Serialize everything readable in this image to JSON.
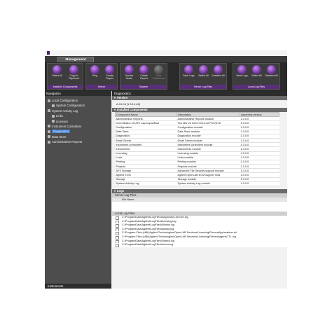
{
  "tab": "Management",
  "ribbon": {
    "groups": [
      {
        "label": "Installed Components",
        "buttons": [
          {
            "label": "Select All"
          },
          {
            "label": "Copy to Clipboard"
          }
        ]
      },
      {
        "label": "Server",
        "buttons": [
          {
            "label": "Ping"
          },
          {
            "label": "Create Report"
          }
        ]
      },
      {
        "label": "System",
        "buttons": [
          {
            "label": "Service Mode"
          },
          {
            "label": "Create Report"
          },
          {
            "label": "Start Dashboard",
            "disabled": true
          }
        ]
      },
      {
        "label": "Server Log Files",
        "buttons": [
          {
            "label": "Save Logs"
          },
          {
            "label": "Select All"
          },
          {
            "label": "Deselect All"
          }
        ]
      },
      {
        "label": "Local Log Files",
        "buttons": [
          {
            "label": "Save Logs"
          },
          {
            "label": "Select All"
          },
          {
            "label": "Deselect All"
          }
        ]
      }
    ]
  },
  "navigation": {
    "title": "Navigation",
    "items": [
      {
        "label": "Local Configuration",
        "sub": false
      },
      {
        "label": "System Configuration",
        "sub": true
      },
      {
        "label": "System Activity Log",
        "sub": false
      },
      {
        "label": "Links",
        "sub": true
      },
      {
        "label": "Licenses",
        "sub": true
      },
      {
        "label": "Instrument Controllers",
        "sub": false
      },
      {
        "label": "Diagnostics",
        "sub": false,
        "selected": true
      },
      {
        "label": "Data Store",
        "sub": false
      },
      {
        "label": "Administrative Reports",
        "sub": false
      }
    ],
    "footer": "Instruments"
  },
  "main": {
    "title": "Diagnostics",
    "version_section": "Version",
    "version_value": "A.01.04 [1.3.10.48]",
    "components_section": "Installed Components",
    "columns": [
      "Component Name",
      "Description",
      "Assembly version"
    ],
    "rows": [
      [
        "Administrative Reports",
        "Administrative Reports module",
        "1.3.0.0"
      ],
      [
        "ChemStation OL/DS LaunchpadMod",
        "Thu Mar 22 2012 04:10:42 PM ON  E",
        "1.3.0.0"
      ],
      [
        "Configuration",
        "Configuration module",
        "1.3.0.0"
      ],
      [
        "Data Store",
        "Data Store module",
        "1.3.0.0"
      ],
      [
        "Diagnostics",
        "Diagnostics module",
        "1.3.0.0"
      ],
      [
        "Email Server",
        "Email Server module",
        "1.3.0.0"
      ],
      [
        "Instrument controllers",
        "Instrument controllers module",
        "1.3.0.0"
      ],
      [
        "Instruments",
        "Instruments module",
        "1.3.0.0"
      ],
      [
        "Licensing",
        "Licensing module",
        "1.3.0.0"
      ],
      [
        "Links",
        "Links module",
        "1.3.0.0"
      ],
      [
        "Printing",
        "Printing module",
        "1.3.0.0"
      ],
      [
        "Projects",
        "Projects module",
        "1.3.0.0"
      ],
      [
        "AFS Storage",
        "Advanced File Security support module",
        "1.3.0.0"
      ],
      [
        "Agilent ECM",
        "Agilent OpenLAB ECM support mod",
        "1.3.0.0"
      ],
      [
        "Storage",
        "Storage module",
        "1.3.0.0"
      ],
      [
        "System Activity Log",
        "System Activity Log module",
        "1.3.0.0"
      ]
    ],
    "logs_section": "Logs",
    "server_logs_title": "Server Log Files",
    "file_name_col": "File Name",
    "local_logs_title": "Local Log Files",
    "local_files": [
      "C:\\ProgramData\\Agilent\\LogFiles\\diagnostics.service.log",
      "C:\\ProgramData\\Agilent\\LogFiles\\licensing.log",
      "C:\\ProgramData\\Agilent\\LogFiles\\Monitor.log",
      "C:\\ProgramData\\Agilent\\LogFiles\\display.log",
      "C:\\Program Files (x86)\\Agilent Technologies\\OpenLAB Services\\Licensing\\FlexeraApp\\readme.txt",
      "C:\\Program Files (x86)\\Agilent Technologies\\OpenLAB Services\\Licensing\\Flexera\\agent\\CTL.log",
      "C:\\ProgramData\\Agilent\\LogFiles\\Shared.log",
      "C:\\ProgramData\\Agilent\\LogFiles\\server.log"
    ]
  }
}
